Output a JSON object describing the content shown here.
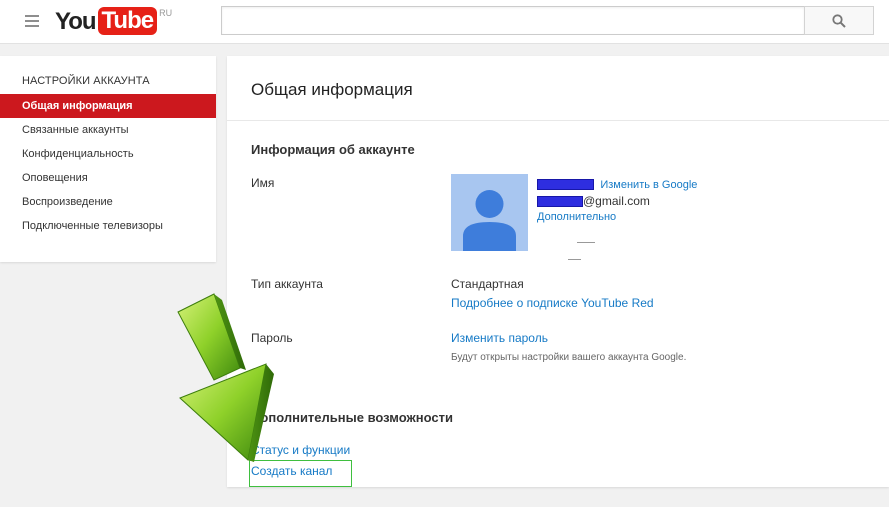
{
  "header": {
    "logo_you": "You",
    "logo_tube": "Tube",
    "logo_region": "RU",
    "search_placeholder": ""
  },
  "sidebar": {
    "heading": "НАСТРОЙКИ АККАУНТА",
    "items": [
      {
        "label": "Общая информация",
        "active": true
      },
      {
        "label": "Связанные аккаунты",
        "active": false
      },
      {
        "label": "Конфиденциальность",
        "active": false
      },
      {
        "label": "Оповещения",
        "active": false
      },
      {
        "label": "Воспроизведение",
        "active": false
      },
      {
        "label": "Подключенные телевизоры",
        "active": false
      }
    ]
  },
  "main": {
    "title": "Общая информация",
    "account_section": {
      "title": "Информация об аккаунте",
      "name_label": "Имя",
      "change_in_google": "Изменить в Google",
      "email_suffix": "@gmail.com",
      "more_link": "Дополнительно",
      "account_type_label": "Тип аккаунта",
      "account_type_value": "Стандартная",
      "red_link": "Подробнее о подписке YouTube Red",
      "password_label": "Пароль",
      "change_password": "Изменить пароль",
      "password_hint": "Будут открыты настройки вашего аккаунта Google."
    },
    "extra_section": {
      "title": "Дополнительные возможности",
      "status_link": "Статус и функции",
      "create_channel": "Создать канал"
    }
  },
  "colors": {
    "brand_red": "#e62117",
    "active_red": "#cc181e",
    "link_blue": "#167ac6",
    "highlight_green": "#3fbf3f",
    "arrow_green": "#7dc41f"
  }
}
